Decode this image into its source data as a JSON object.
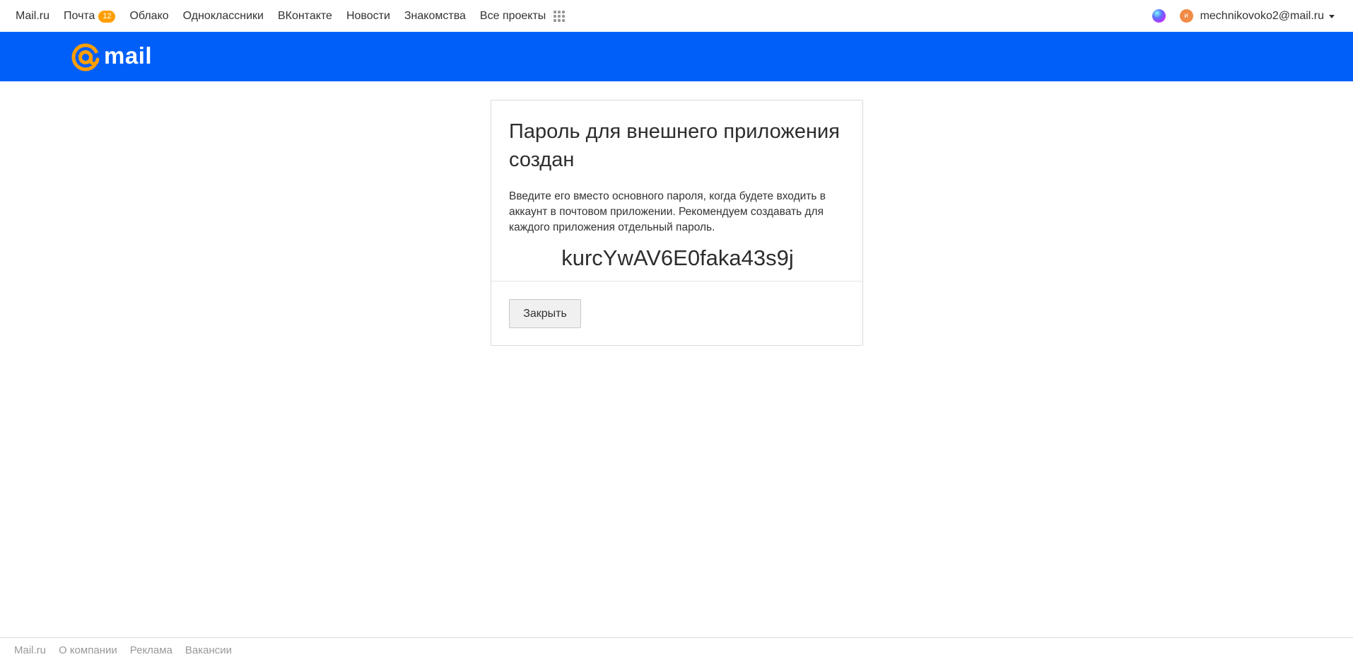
{
  "topbar": {
    "nav": [
      {
        "label": "Mail.ru"
      },
      {
        "label": "Почта",
        "badge": "12"
      },
      {
        "label": "Облако"
      },
      {
        "label": "Одноклассники"
      },
      {
        "label": "ВКонтакте"
      },
      {
        "label": "Новости"
      },
      {
        "label": "Знакомства"
      },
      {
        "label": "Все проекты"
      }
    ],
    "user": {
      "avatar_letter": "и",
      "email": "mechnikovoko2@mail.ru"
    }
  },
  "header": {
    "logo_text": "mail"
  },
  "card": {
    "title": "Пароль для внешнего приложения создан",
    "description": "Введите его вместо основного пароля, когда будете входить в аккаунт в почтовом приложении. Рекомендуем создавать для каждого приложения отдельный пароль.",
    "password": "kurcYwAV6E0faka43s9j",
    "close_label": "Закрыть"
  },
  "footer": {
    "links": [
      {
        "label": "Mail.ru"
      },
      {
        "label": "О компании"
      },
      {
        "label": "Реклама"
      },
      {
        "label": "Вакансии"
      }
    ]
  },
  "colors": {
    "header_blue": "#005ff9",
    "logo_orange": "#ff9e00",
    "badge_orange": "#ff9e00",
    "avatar_orange": "#f08a45"
  },
  "icons": [
    "grid-icon",
    "marusia-icon",
    "avatar",
    "chevron-down-icon",
    "mail-at-logo-icon"
  ]
}
